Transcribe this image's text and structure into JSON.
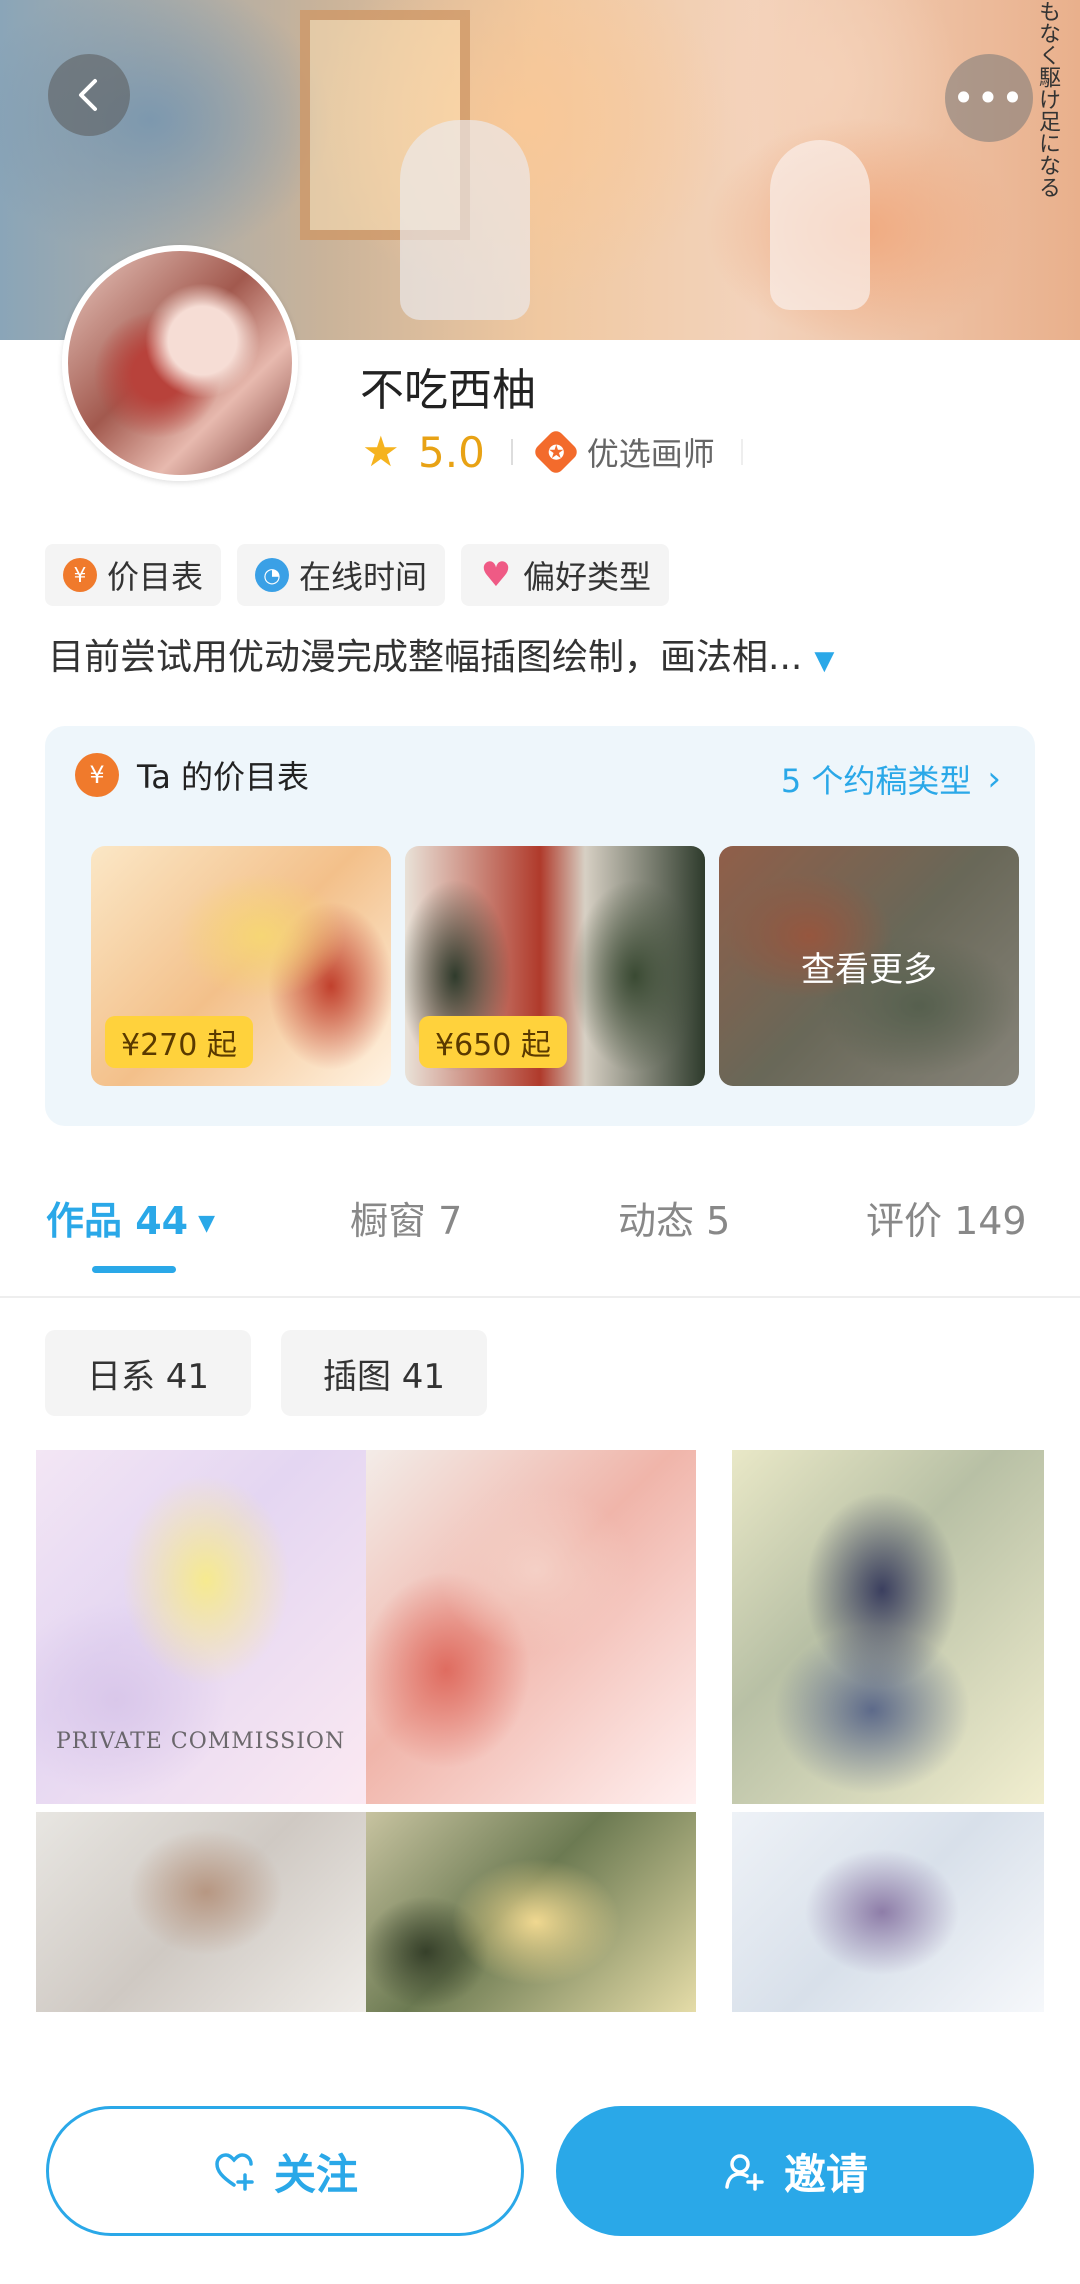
{
  "header": {
    "banner_text": "もなく駆け足になる"
  },
  "profile": {
    "name": "不吃西柚",
    "rating": "5.0",
    "badge": "优选画师"
  },
  "tags": [
    {
      "label": "价目表",
      "icon": "price-icon"
    },
    {
      "label": "在线时间",
      "icon": "clock-icon"
    },
    {
      "label": "偏好类型",
      "icon": "heart-icon"
    }
  ],
  "description": "目前尝试用优动漫完成整幅插图绘制，画法相...",
  "price_card": {
    "title": "Ta 的价目表",
    "link": "5 个约稿类型",
    "items": [
      {
        "price": "¥270 起"
      },
      {
        "price": "¥650 起"
      },
      {
        "label": "查看更多"
      }
    ]
  },
  "tabs": [
    {
      "label": "作品 44",
      "active": true
    },
    {
      "label": "橱窗 7"
    },
    {
      "label": "动态 5"
    },
    {
      "label": "评价 149"
    }
  ],
  "filters": [
    "日系 41",
    "插图 41"
  ],
  "gallery": {
    "stamp": "PRIVATE COMMISSION"
  },
  "actions": {
    "follow": "关注",
    "invite": "邀请"
  },
  "colors": {
    "accent": "#2aa8e8",
    "rating": "#e8a214",
    "price_tag": "#ffd23c",
    "badge": "#f36b2c"
  }
}
